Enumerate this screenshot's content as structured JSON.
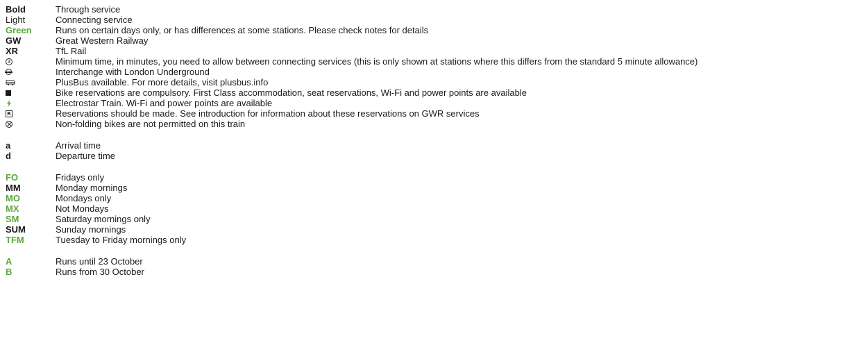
{
  "colors": {
    "text": "#1a1a1a",
    "green": "#5aa83c",
    "background": "#ffffff"
  },
  "service_types": [
    {
      "key": "Bold",
      "desc": "Through service",
      "style": "bold"
    },
    {
      "key": "Light",
      "desc": "Connecting service",
      "style": "light"
    },
    {
      "key": "Green",
      "desc": "Runs on certain days only, or has differences at some stations. Please check notes for details",
      "style": "green"
    },
    {
      "key": "GW",
      "desc": "Great Western Railway",
      "style": "bold"
    },
    {
      "key": "XR",
      "desc": "TfL Rail",
      "style": "bold"
    }
  ],
  "symbols": [
    {
      "icon": "circled-three-icon",
      "desc": "Minimum time, in minutes, you need to allow between connecting services (this is only shown at stations where this differs from the standard 5 minute allowance)"
    },
    {
      "icon": "underground-roundel-icon",
      "desc": "Interchange with London Underground"
    },
    {
      "icon": "plusbus-icon",
      "desc": "PlusBus available. For more details, visit plusbus.info"
    },
    {
      "icon": "black-square-icon",
      "desc": "Bike reservations are compulsory. First Class accommodation, seat reservations, Wi-Fi and power points are available"
    },
    {
      "icon": "lightning-bolt-icon",
      "desc": "Electrostar Train. Wi-Fi and power points are available"
    },
    {
      "icon": "reservation-r-icon",
      "desc": "Reservations should be made. See introduction for information about these reservations on GWR services"
    },
    {
      "icon": "no-bike-icon",
      "desc": "Non-folding bikes are not permitted on this train"
    }
  ],
  "time_codes": [
    {
      "key": "a",
      "desc": "Arrival time"
    },
    {
      "key": "d",
      "desc": "Departure time"
    }
  ],
  "day_codes": [
    {
      "key": "FO",
      "desc": "Fridays only",
      "style": "green"
    },
    {
      "key": "MM",
      "desc": "Monday mornings",
      "style": "bold"
    },
    {
      "key": "MO",
      "desc": "Mondays only",
      "style": "green"
    },
    {
      "key": "MX",
      "desc": "Not Mondays",
      "style": "green"
    },
    {
      "key": "SM",
      "desc": "Saturday mornings only",
      "style": "green"
    },
    {
      "key": "SUM",
      "desc": "Sunday mornings",
      "style": "bold"
    },
    {
      "key": "TFM",
      "desc": "Tuesday to Friday mornings only",
      "style": "green"
    }
  ],
  "notes": [
    {
      "key": "A",
      "desc": "Runs until 23 October"
    },
    {
      "key": "B",
      "desc": "Runs from 30 October"
    }
  ]
}
